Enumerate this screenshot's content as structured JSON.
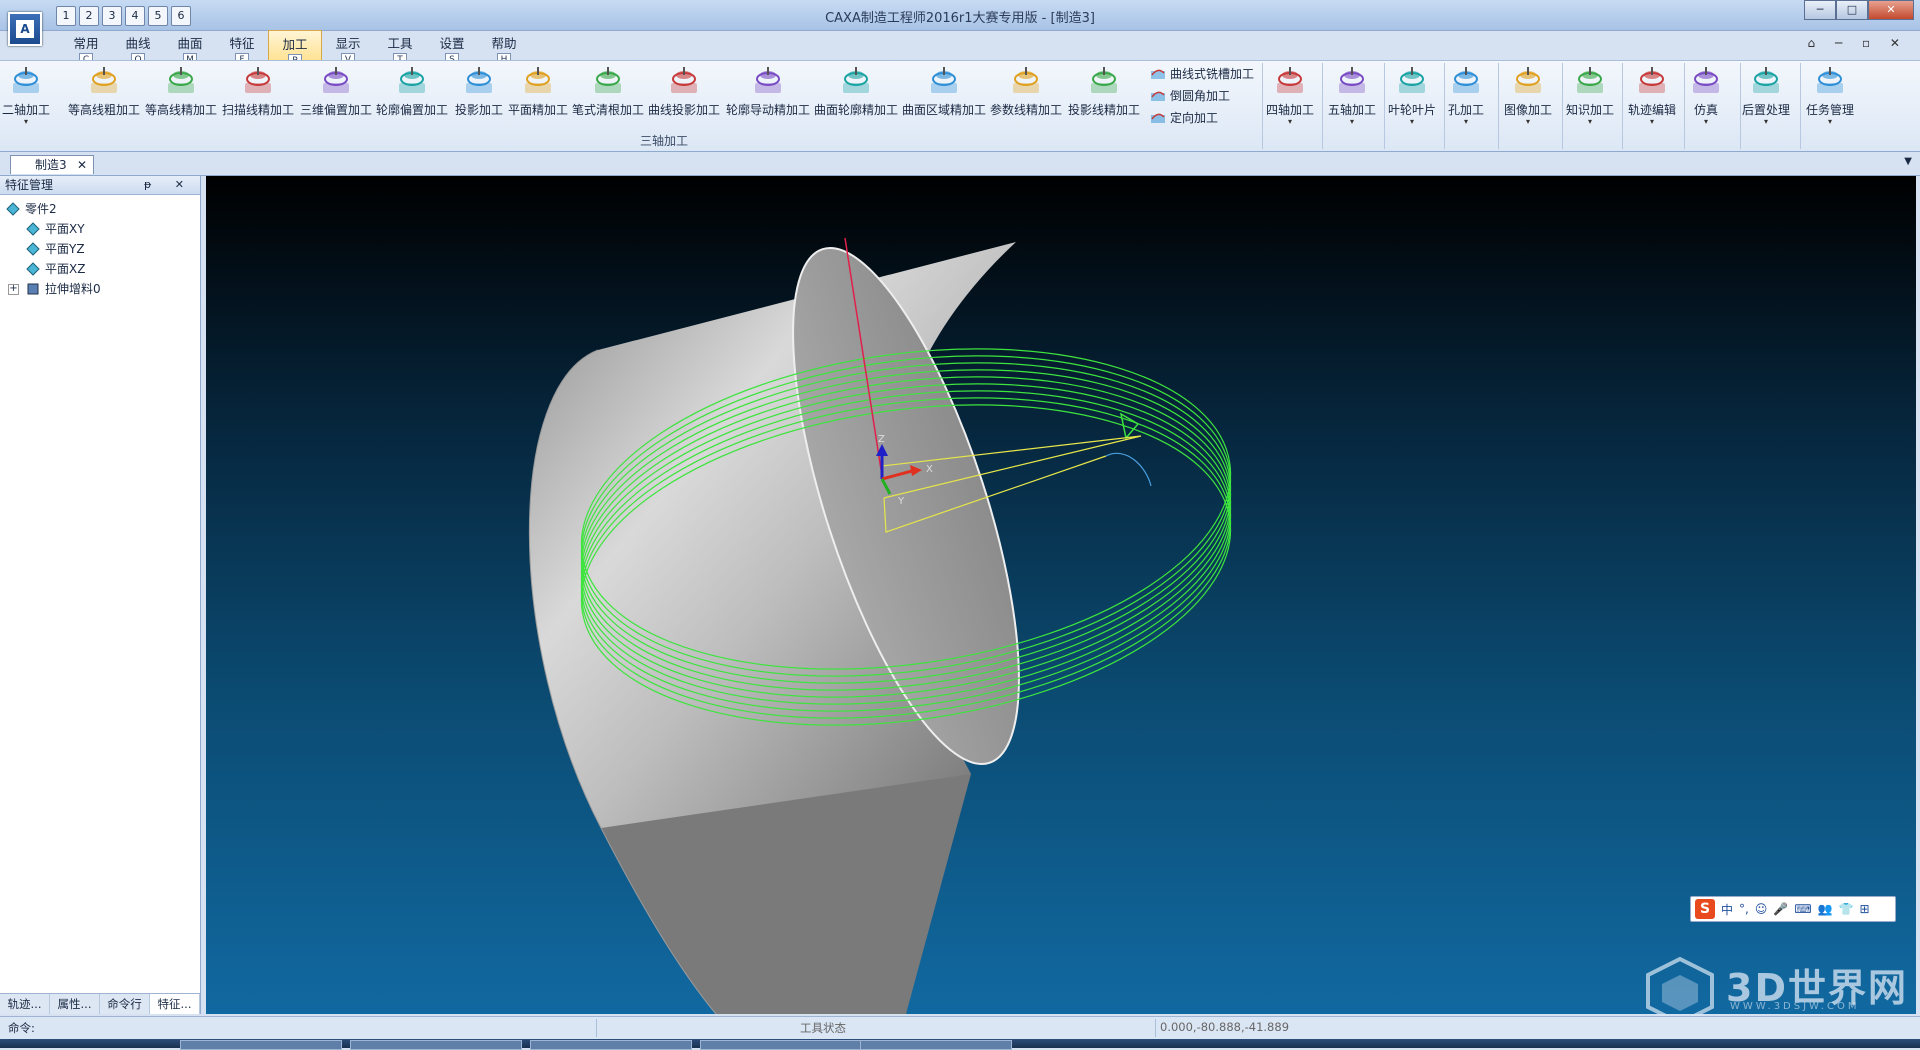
{
  "window": {
    "title": "CAXA制造工程师2016r1大赛专用版 - [制造3]",
    "app_icon_letter": "A",
    "controls": [
      "─",
      "□",
      "✕"
    ]
  },
  "quick_access": [
    "1",
    "2",
    "3",
    "4",
    "5",
    "6"
  ],
  "menu_tabs": [
    {
      "label": "常用",
      "key": "C"
    },
    {
      "label": "曲线",
      "key": "Q"
    },
    {
      "label": "曲面",
      "key": "M"
    },
    {
      "label": "特征",
      "key": "F"
    },
    {
      "label": "加工",
      "key": "P"
    },
    {
      "label": "显示",
      "key": "V"
    },
    {
      "label": "工具",
      "key": "T"
    },
    {
      "label": "设置",
      "key": "S"
    },
    {
      "label": "帮助",
      "key": "H"
    }
  ],
  "active_menu_tab": "加工",
  "mdi_controls": "⌂ ─ ▫ ✕",
  "ribbon": {
    "buttons": [
      {
        "label": "二轴加工",
        "icon": "two-axis-icon"
      },
      {
        "label": "等高线粗加工",
        "icon": "contour-rough-icon"
      },
      {
        "label": "等高线精加工",
        "icon": "contour-finish-icon"
      },
      {
        "label": "扫描线精加工",
        "icon": "scanline-finish-icon"
      },
      {
        "label": "三维偏置加工",
        "icon": "3d-offset-icon"
      },
      {
        "label": "轮廓偏置加工",
        "icon": "profile-offset-icon"
      },
      {
        "label": "投影加工",
        "icon": "projection-icon"
      },
      {
        "label": "平面精加工",
        "icon": "plane-finish-icon"
      },
      {
        "label": "笔式清根加工",
        "icon": "pencil-clean-icon"
      },
      {
        "label": "曲线投影加工",
        "icon": "curve-projection-icon"
      },
      {
        "label": "轮廓导动精加工",
        "icon": "profile-sweep-icon"
      },
      {
        "label": "曲面轮廓精加工",
        "icon": "surface-profile-icon"
      },
      {
        "label": "曲面区域精加工",
        "icon": "surface-region-icon"
      },
      {
        "label": "参数线精加工",
        "icon": "parameter-line-icon"
      },
      {
        "label": "投影线精加工",
        "icon": "projection-line-icon"
      }
    ],
    "small_buttons": [
      {
        "label": "曲线式铣槽加工",
        "icon": "curve-slot-icon"
      },
      {
        "label": "倒圆角加工",
        "icon": "fillet-icon"
      },
      {
        "label": "定向加工",
        "icon": "directional-icon"
      }
    ],
    "group_label": "三轴加工",
    "right_buttons": [
      {
        "label": "四轴加工",
        "icon": "four-axis-icon"
      },
      {
        "label": "五轴加工",
        "icon": "five-axis-icon"
      },
      {
        "label": "叶轮叶片",
        "icon": "impeller-icon"
      },
      {
        "label": "孔加工",
        "icon": "hole-icon"
      },
      {
        "label": "图像加工",
        "icon": "image-machining-icon"
      },
      {
        "label": "知识加工",
        "icon": "knowledge-icon"
      },
      {
        "label": "轨迹编辑",
        "icon": "path-edit-icon"
      },
      {
        "label": "仿真",
        "icon": "simulation-icon"
      },
      {
        "label": "后置处理",
        "icon": "post-process-icon"
      },
      {
        "label": "任务管理",
        "icon": "task-manager-icon"
      }
    ]
  },
  "document_tab": {
    "label": "制造3",
    "close": "✕"
  },
  "panel": {
    "title": "特征管理",
    "controls": "ᵽ ✕",
    "tree": [
      {
        "label": "零件2",
        "level": 0
      },
      {
        "label": "平面XY",
        "level": 1
      },
      {
        "label": "平面YZ",
        "level": 1
      },
      {
        "label": "平面XZ",
        "level": 1
      },
      {
        "label": "拉伸增料0",
        "level": 1,
        "expander": "+"
      }
    ],
    "tabs": [
      "轨迹...",
      "属性...",
      "命令行",
      "特征..."
    ],
    "active_tab": "特征..."
  },
  "viewport": {
    "axis_labels": {
      "x": "X",
      "y": "Y",
      "z": "Z"
    },
    "colors": {
      "toolpath": "#3ee43e",
      "leadline": "#e6e64a",
      "zaxis": "#e0204a",
      "edge": "#e8e8e8"
    }
  },
  "ime": {
    "logo": "S",
    "items": [
      "中",
      "°,",
      "☺",
      "🎤",
      "⌨",
      "👥",
      "👕",
      "⊞"
    ]
  },
  "watermark": {
    "text": "3D世界网",
    "sub": "WWW.3DSJW.COM"
  },
  "status": {
    "command_label": "命令:",
    "tool_state": "工具状态",
    "coordinates": "0.000,-80.888,-41.889"
  }
}
